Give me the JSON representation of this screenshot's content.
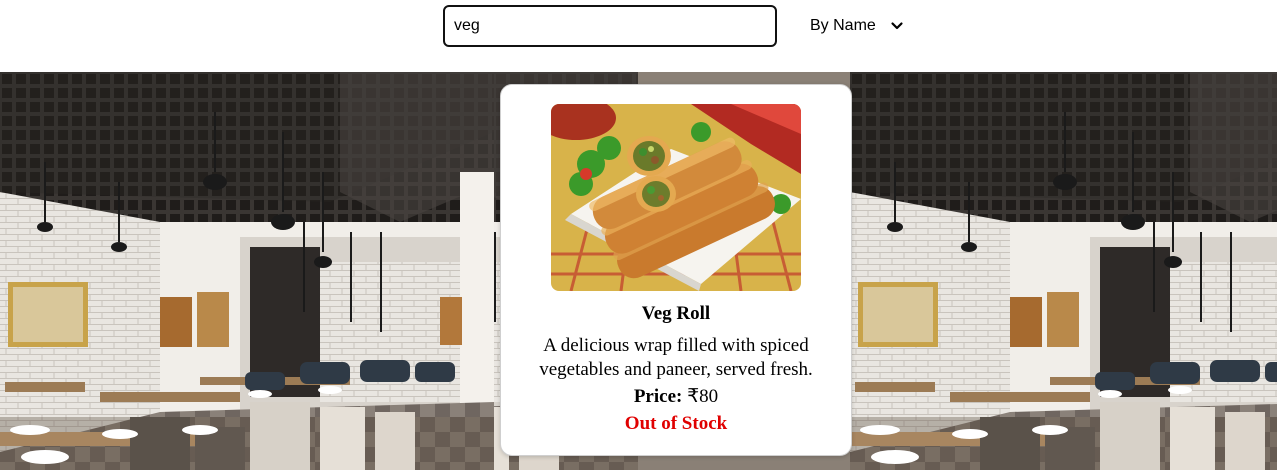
{
  "search": {
    "value": "veg",
    "placeholder": ""
  },
  "sort": {
    "selected": "By Name",
    "icon": "chevron-down-icon"
  },
  "background": {
    "description_icon": "restaurant-interior-photo"
  },
  "products": [
    {
      "name": "Veg Roll",
      "description": "A delicious wrap filled with spiced vegetables and paneer, served fresh.",
      "price_label": "Price:",
      "price_value": "₹80",
      "stock_status": "Out of Stock",
      "image_icon": "veg-roll-photo"
    }
  ],
  "colors": {
    "out_of_stock": "#e00000",
    "search_border": "#111111",
    "card_background": "#ffffff"
  }
}
